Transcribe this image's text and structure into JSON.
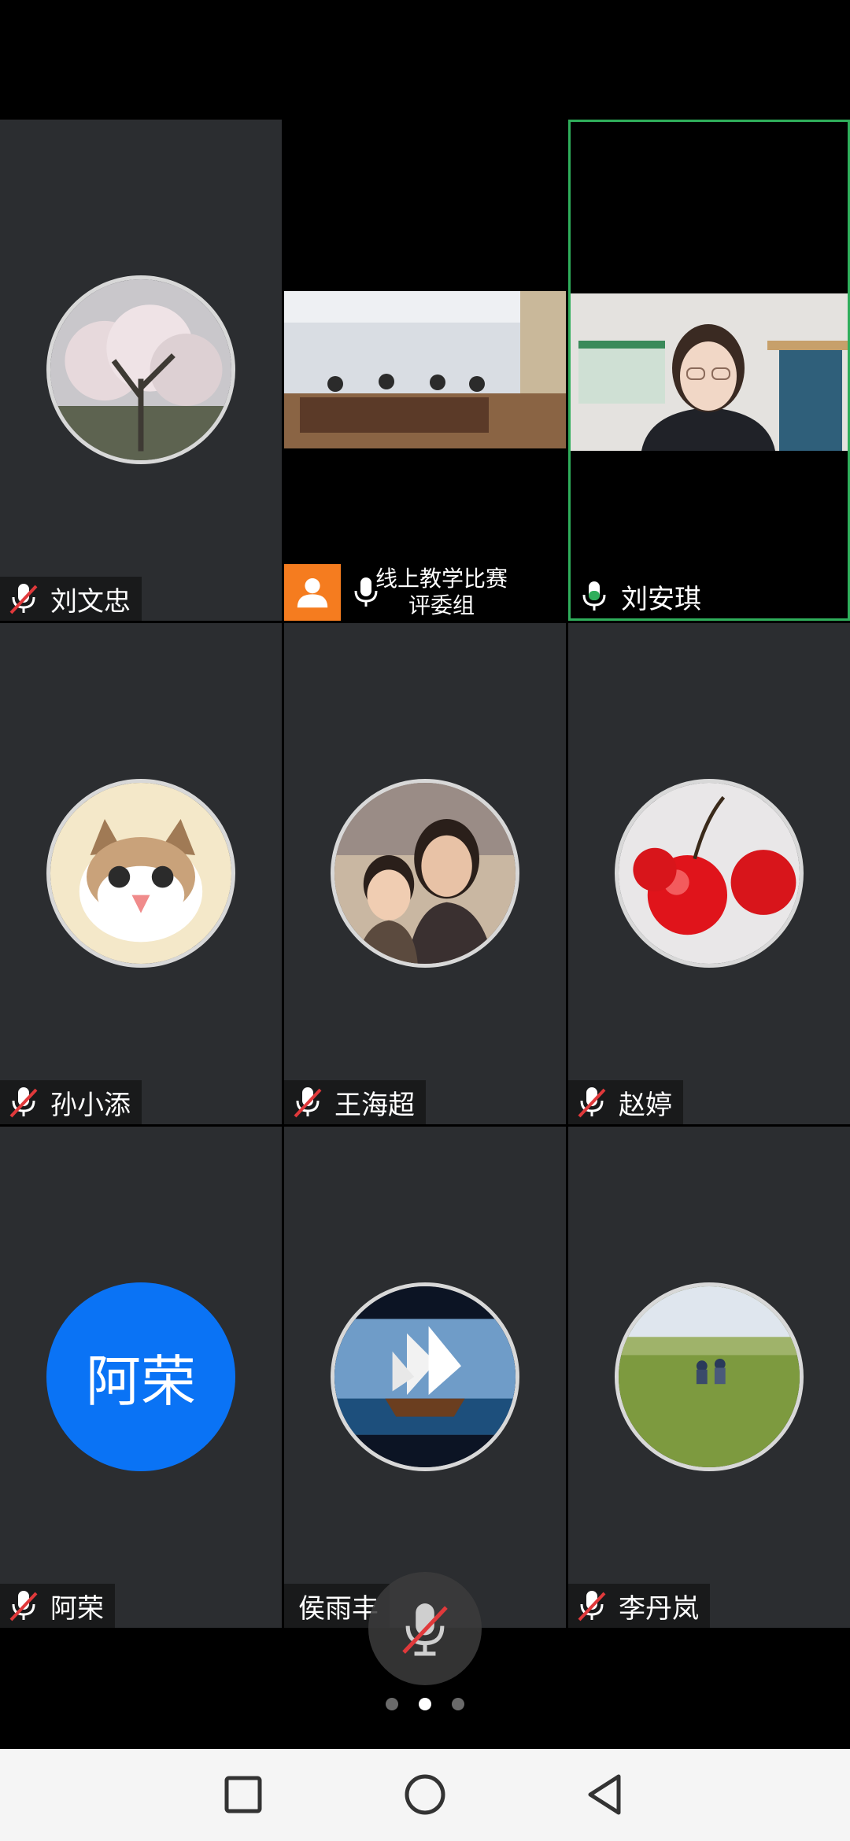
{
  "participants": [
    {
      "name": "刘文忠",
      "mic": "muted",
      "type": "avatar",
      "avatar": "blossom-tree-photo"
    },
    {
      "name": "线上教学比赛\n评委组",
      "name_line1": "线上教学比赛",
      "name_line2": "评委组",
      "mic": "unmuted",
      "type": "video",
      "video": "judges-meeting-room"
    },
    {
      "name": "刘安琪",
      "mic": "speaking",
      "type": "video",
      "video": "speaker-woman-glasses",
      "active_speaker": true
    },
    {
      "name": "孙小添",
      "mic": "muted",
      "type": "avatar",
      "avatar": "cartoon-cat-photo"
    },
    {
      "name": "王海超",
      "mic": "muted",
      "type": "avatar",
      "avatar": "mother-and-child-photo"
    },
    {
      "name": "赵婷",
      "mic": "muted",
      "type": "avatar",
      "avatar": "cherries-photo"
    },
    {
      "name": "阿荣",
      "mic": "muted",
      "type": "letter-avatar",
      "avatar_text": "阿荣"
    },
    {
      "name": "侯雨丰",
      "mic": "none",
      "type": "avatar",
      "avatar": "sailing-ship-photo"
    },
    {
      "name": "李丹岚",
      "mic": "muted",
      "type": "avatar",
      "avatar": "grassland-people-photo"
    }
  ],
  "controls": {
    "mute_button": "microphone-off-icon"
  },
  "pager": {
    "page_count": 3,
    "current_page": 2
  },
  "nav": {
    "buttons": [
      "recents-square-icon",
      "home-circle-icon",
      "back-triangle-icon"
    ]
  },
  "colors": {
    "active_border": "#2fae5b",
    "speaking_mic": "#2fae5b",
    "muted_slash": "#e0393b",
    "letter_avatar": "#0a73f5",
    "orange_badge": "#f57c1f"
  }
}
